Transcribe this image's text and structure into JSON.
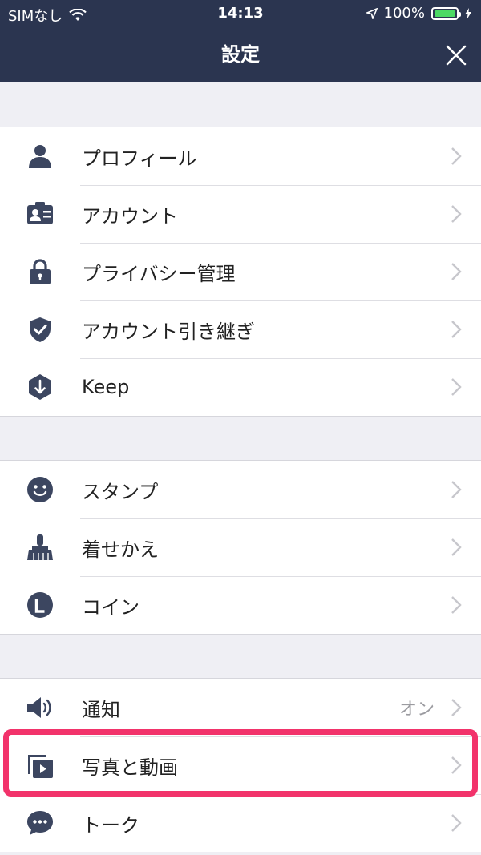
{
  "status_bar": {
    "carrier": "SIMなし",
    "time": "14:13",
    "battery_percent": "100%"
  },
  "nav": {
    "title": "設定"
  },
  "sections": [
    {
      "items": [
        {
          "label": "プロフィール",
          "icon": "person-icon"
        },
        {
          "label": "アカウント",
          "icon": "id-card-icon"
        },
        {
          "label": "プライバシー管理",
          "icon": "lock-icon"
        },
        {
          "label": "アカウント引き継ぎ",
          "icon": "shield-check-icon"
        },
        {
          "label": "Keep",
          "icon": "keep-download-icon"
        }
      ]
    },
    {
      "items": [
        {
          "label": "スタンプ",
          "icon": "smiley-icon"
        },
        {
          "label": "着せかえ",
          "icon": "brush-icon"
        },
        {
          "label": "コイン",
          "icon": "coin-icon"
        }
      ]
    },
    {
      "items": [
        {
          "label": "通知",
          "value": "オン",
          "icon": "speaker-icon"
        },
        {
          "label": "写真と動画",
          "icon": "photo-video-icon"
        },
        {
          "label": "トーク",
          "icon": "chat-bubble-icon"
        }
      ]
    }
  ],
  "colors": {
    "nav_background": "#2b3550",
    "icon": "#3c4660",
    "highlight": "#f2336b",
    "page_background": "#efeff4"
  }
}
